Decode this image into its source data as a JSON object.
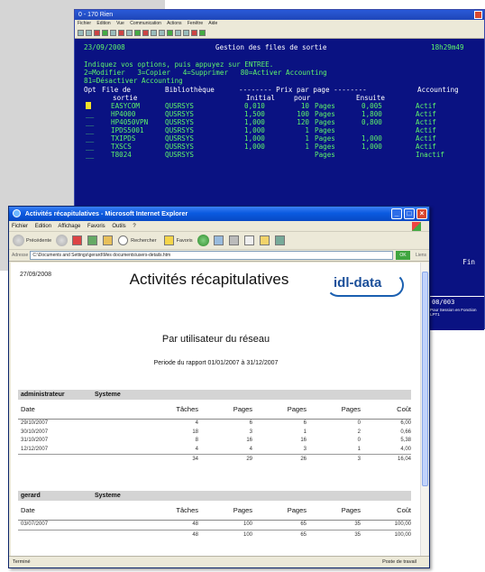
{
  "terminal": {
    "title": "0 - 170 Rien",
    "menu": [
      "Fichier",
      "Edition",
      "Vue",
      "Communication",
      "Actions",
      "Fenêtre",
      "Aide"
    ],
    "date": "23/09/2008",
    "screen_title": "Gestion des files de sortie",
    "time": "18h29m49",
    "instructions": "Indiquez vos options, puis appuyez sur ENTREE.",
    "options_line1": "2=Modifier   3=Copier   4=Supprimer   80=Activer Accounting",
    "options_line2": "81=Désactiver Accounting",
    "col_opt": "Opt",
    "col_file": "File de",
    "col_file2": "sortie",
    "col_lib": "Bibliothèque",
    "col_initial": "Initial",
    "col_prix": "-------- Prix par page --------",
    "col_pour": "pour",
    "col_ensuite": "Ensuite",
    "col_accounting": "Accounting",
    "rows": [
      {
        "name": "EASYCOM",
        "lib": "QUSRSYS",
        "initial": "0,010",
        "pour": "10",
        "unit": "Pages",
        "ensuite": "0,005",
        "acc": "Actif",
        "selected": true
      },
      {
        "name": "HP4000",
        "lib": "QUSRSYS",
        "initial": "1,500",
        "pour": "100",
        "unit": "Pages",
        "ensuite": "1,800",
        "acc": "Actif"
      },
      {
        "name": "HP4050VPN",
        "lib": "QUSRSYS",
        "initial": "1,000",
        "pour": "120",
        "unit": "Pages",
        "ensuite": "0,800",
        "acc": "Actif"
      },
      {
        "name": "IPDS5001",
        "lib": "QUSRSYS",
        "initial": "1,000",
        "pour": "1",
        "unit": "Pages",
        "ensuite": "",
        "acc": "Actif"
      },
      {
        "name": "TXIPDS",
        "lib": "QUSRSYS",
        "initial": "1,000",
        "pour": "1",
        "unit": "Pages",
        "ensuite": "1,000",
        "acc": "Actif"
      },
      {
        "name": "TXSCS",
        "lib": "QUSRSYS",
        "initial": "1,000",
        "pour": "1",
        "unit": "Pages",
        "ensuite": "1,000",
        "acc": "Actif"
      },
      {
        "name": "T8024",
        "lib": "QUSRSYS",
        "initial": "",
        "pour": "",
        "unit": "Pages",
        "ensuite": "",
        "acc": "Inactif"
      }
    ],
    "fin": "Fin",
    "counter": "08/003",
    "status_note": "Pour Session en Fonction LPT1"
  },
  "ie": {
    "title": "Activités récapitulatives - Microsoft Internet Explorer",
    "menu": [
      "Fichier",
      "Edition",
      "Affichage",
      "Favoris",
      "Outils",
      "?"
    ],
    "toolbar": {
      "back": "Précédente",
      "search": "Rechercher",
      "favorites": "Favoris"
    },
    "address_label": "Adresse",
    "address": "C:\\Documents and Settings\\gerard\\Mes documents\\users-details.htm",
    "go": "OK",
    "links": "Liens",
    "status_left": "Terminé",
    "status_zone": "Poste de travail"
  },
  "report": {
    "date": "27/09/2008",
    "title": "Activités récapitulatives",
    "logo": "idl-data",
    "subtitle": "Par utilisateur du réseau",
    "period": "Periode du rapport 01/01/2007 à 31/12/2007",
    "columns": {
      "date": "Date",
      "taches": "Tâches",
      "pages1": "Pages",
      "pages2": "Pages",
      "pages3": "Pages",
      "cout": "Coût"
    },
    "users": [
      {
        "name": "administrateur",
        "group": "Systeme",
        "rows": [
          {
            "date": "29/10/2007",
            "taches": "4",
            "p1": "6",
            "p2": "6",
            "p3": "0",
            "cout": "6,00"
          },
          {
            "date": "30/10/2007",
            "taches": "18",
            "p1": "3",
            "p2": "1",
            "p3": "2",
            "cout": "0,66"
          },
          {
            "date": "31/10/2007",
            "taches": "8",
            "p1": "16",
            "p2": "16",
            "p3": "0",
            "cout": "5,38"
          },
          {
            "date": "12/12/2007",
            "taches": "4",
            "p1": "4",
            "p2": "3",
            "p3": "1",
            "cout": "4,00"
          }
        ],
        "total": {
          "taches": "34",
          "p1": "29",
          "p2": "26",
          "p3": "3",
          "cout": "16,04"
        }
      },
      {
        "name": "gerard",
        "group": "Systeme",
        "rows": [
          {
            "date": "03/07/2007",
            "taches": "48",
            "p1": "100",
            "p2": "65",
            "p3": "35",
            "cout": "100,00"
          }
        ],
        "total": {
          "taches": "48",
          "p1": "100",
          "p2": "65",
          "p3": "35",
          "cout": "100,00"
        }
      }
    ]
  }
}
